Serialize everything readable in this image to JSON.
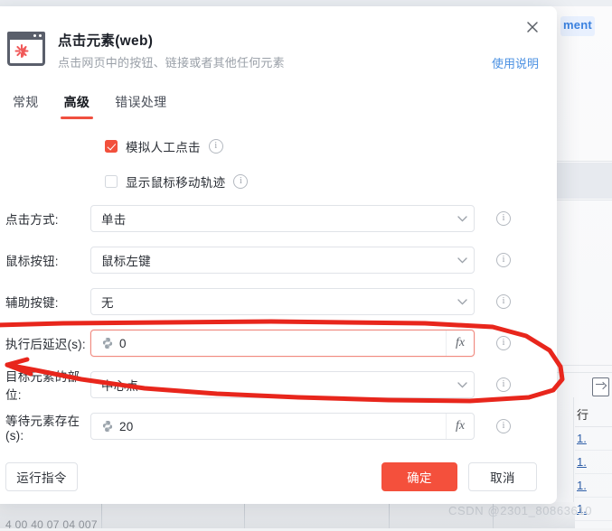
{
  "dialog": {
    "title": "点击元素(web)",
    "subtitle": "点击网页中的按钮、链接或者其他任何元素",
    "help_link": "使用说明",
    "close_icon": "close-icon",
    "app_icon": "click-element-web-icon",
    "accent_color": "#f4503c",
    "link_color": "#4a90e2"
  },
  "tabs": [
    {
      "label": "常规",
      "active": false
    },
    {
      "label": "高级",
      "active": true
    },
    {
      "label": "错误处理",
      "active": false
    }
  ],
  "checkboxes": [
    {
      "label": "模拟人工点击",
      "checked": true,
      "info": "info-icon"
    },
    {
      "label": "显示鼠标移动轨迹",
      "checked": false,
      "info": "info-icon"
    }
  ],
  "fields": [
    {
      "label": "点击方式:",
      "value": "单击",
      "control": "select",
      "icon": null,
      "info": "info-icon"
    },
    {
      "label": "鼠标按钮:",
      "value": "鼠标左键",
      "control": "select",
      "icon": null,
      "info": "info-icon"
    },
    {
      "label": "辅助按键:",
      "value": "无",
      "control": "select",
      "icon": null,
      "info": "info-icon"
    },
    {
      "label": "执行后延迟(s):",
      "value": "0",
      "control": "fx",
      "icon": "python-icon",
      "info": "info-icon",
      "fx_label": "fx",
      "highlighted": true
    },
    {
      "label": "目标元素的部位:",
      "value": "中心点",
      "control": "select",
      "icon": null,
      "info": "info-icon"
    },
    {
      "label": "等待元素存在(s):",
      "value": "20",
      "control": "fx",
      "icon": "python-icon",
      "info": "info-icon",
      "fx_label": "fx"
    }
  ],
  "footer": {
    "run_label": "运行指令",
    "ok_label": "确定",
    "cancel_label": "取消"
  },
  "background": {
    "chip_text": "ment",
    "table_header": "行",
    "table_rows": [
      "1.",
      "1.",
      "1.",
      "1."
    ],
    "watermark": "CSDN @2301_80863610",
    "ghost_row": "4 00 40 07 04 007"
  },
  "annotation": {
    "color": "#e8261c",
    "shape": "hand-drawn-ellipse-around-delay-and-position-fields"
  }
}
